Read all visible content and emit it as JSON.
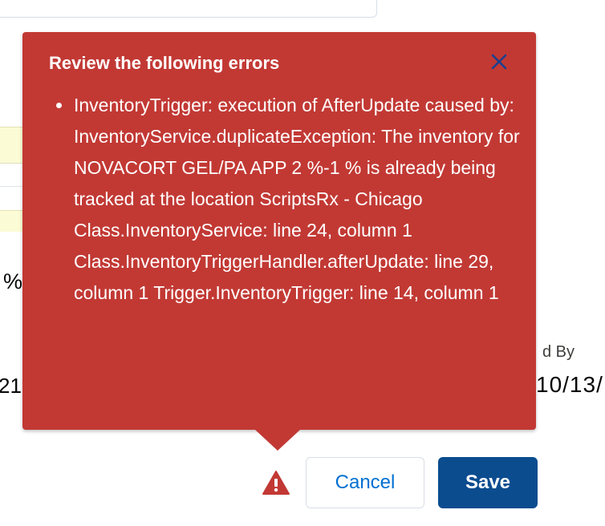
{
  "background": {
    "percent_fragment": "%",
    "number_fragment": "21",
    "column_label_fragment": "d By",
    "date_fragment": "10/13/"
  },
  "error_popover": {
    "title": "Review the following errors",
    "close_icon": "close-icon",
    "messages": [
      "InventoryTrigger: execution of AfterUpdate caused by: InventoryService.duplicateException: The inventory for NOVACORT GEL/PA APP 2 %-1 % is already being tracked at the location ScriptsRx - Chicago Class.InventoryService: line 24, column 1 Class.InventoryTriggerHandler.afterUpdate: line 29, column 1 Trigger.InventoryTrigger: line 14, column 1"
    ],
    "background_color": "#c23934"
  },
  "footer": {
    "warning_icon": "warning-icon",
    "cancel_label": "Cancel",
    "save_label": "Save",
    "save_color": "#0b4c8f",
    "cancel_text_color": "#0070d2"
  }
}
